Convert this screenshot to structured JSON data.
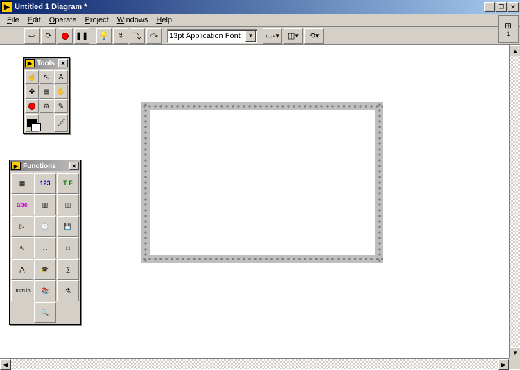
{
  "window": {
    "title": "Untitled 1 Diagram *"
  },
  "menu": {
    "file": "File",
    "edit": "Edit",
    "operate": "Operate",
    "project": "Project",
    "windows": "Windows",
    "help": "Help"
  },
  "toolbar": {
    "run": "⇨",
    "run_cont": "⟳",
    "abort": "●",
    "pause": "❚❚",
    "highlight": "💡",
    "retain": "↯",
    "step_into": "⤵",
    "step_over": "⤼",
    "font_label": "13pt Application Font",
    "align": "▭▫▾",
    "distribute": "◫▾",
    "reorder": "⟲▾"
  },
  "indicator": {
    "label": "1"
  },
  "palettes": {
    "tools": {
      "title": "Tools",
      "items": [
        "op",
        "pos",
        "txt",
        "wir",
        "obj",
        "scr",
        "brk",
        "prb",
        "col",
        "cfg",
        "cbg",
        "pnt"
      ]
    },
    "functions": {
      "title": "Functions",
      "items": [
        "Struct",
        "123",
        "T F",
        "abc",
        "[ ]",
        "Clstr",
        "▷",
        "Cmp",
        "File",
        "Wave",
        "Anlys",
        "DAQ",
        "Sig",
        "Motn",
        "Math",
        "InstrLib",
        "Lib",
        "User",
        "Srch"
      ]
    }
  }
}
